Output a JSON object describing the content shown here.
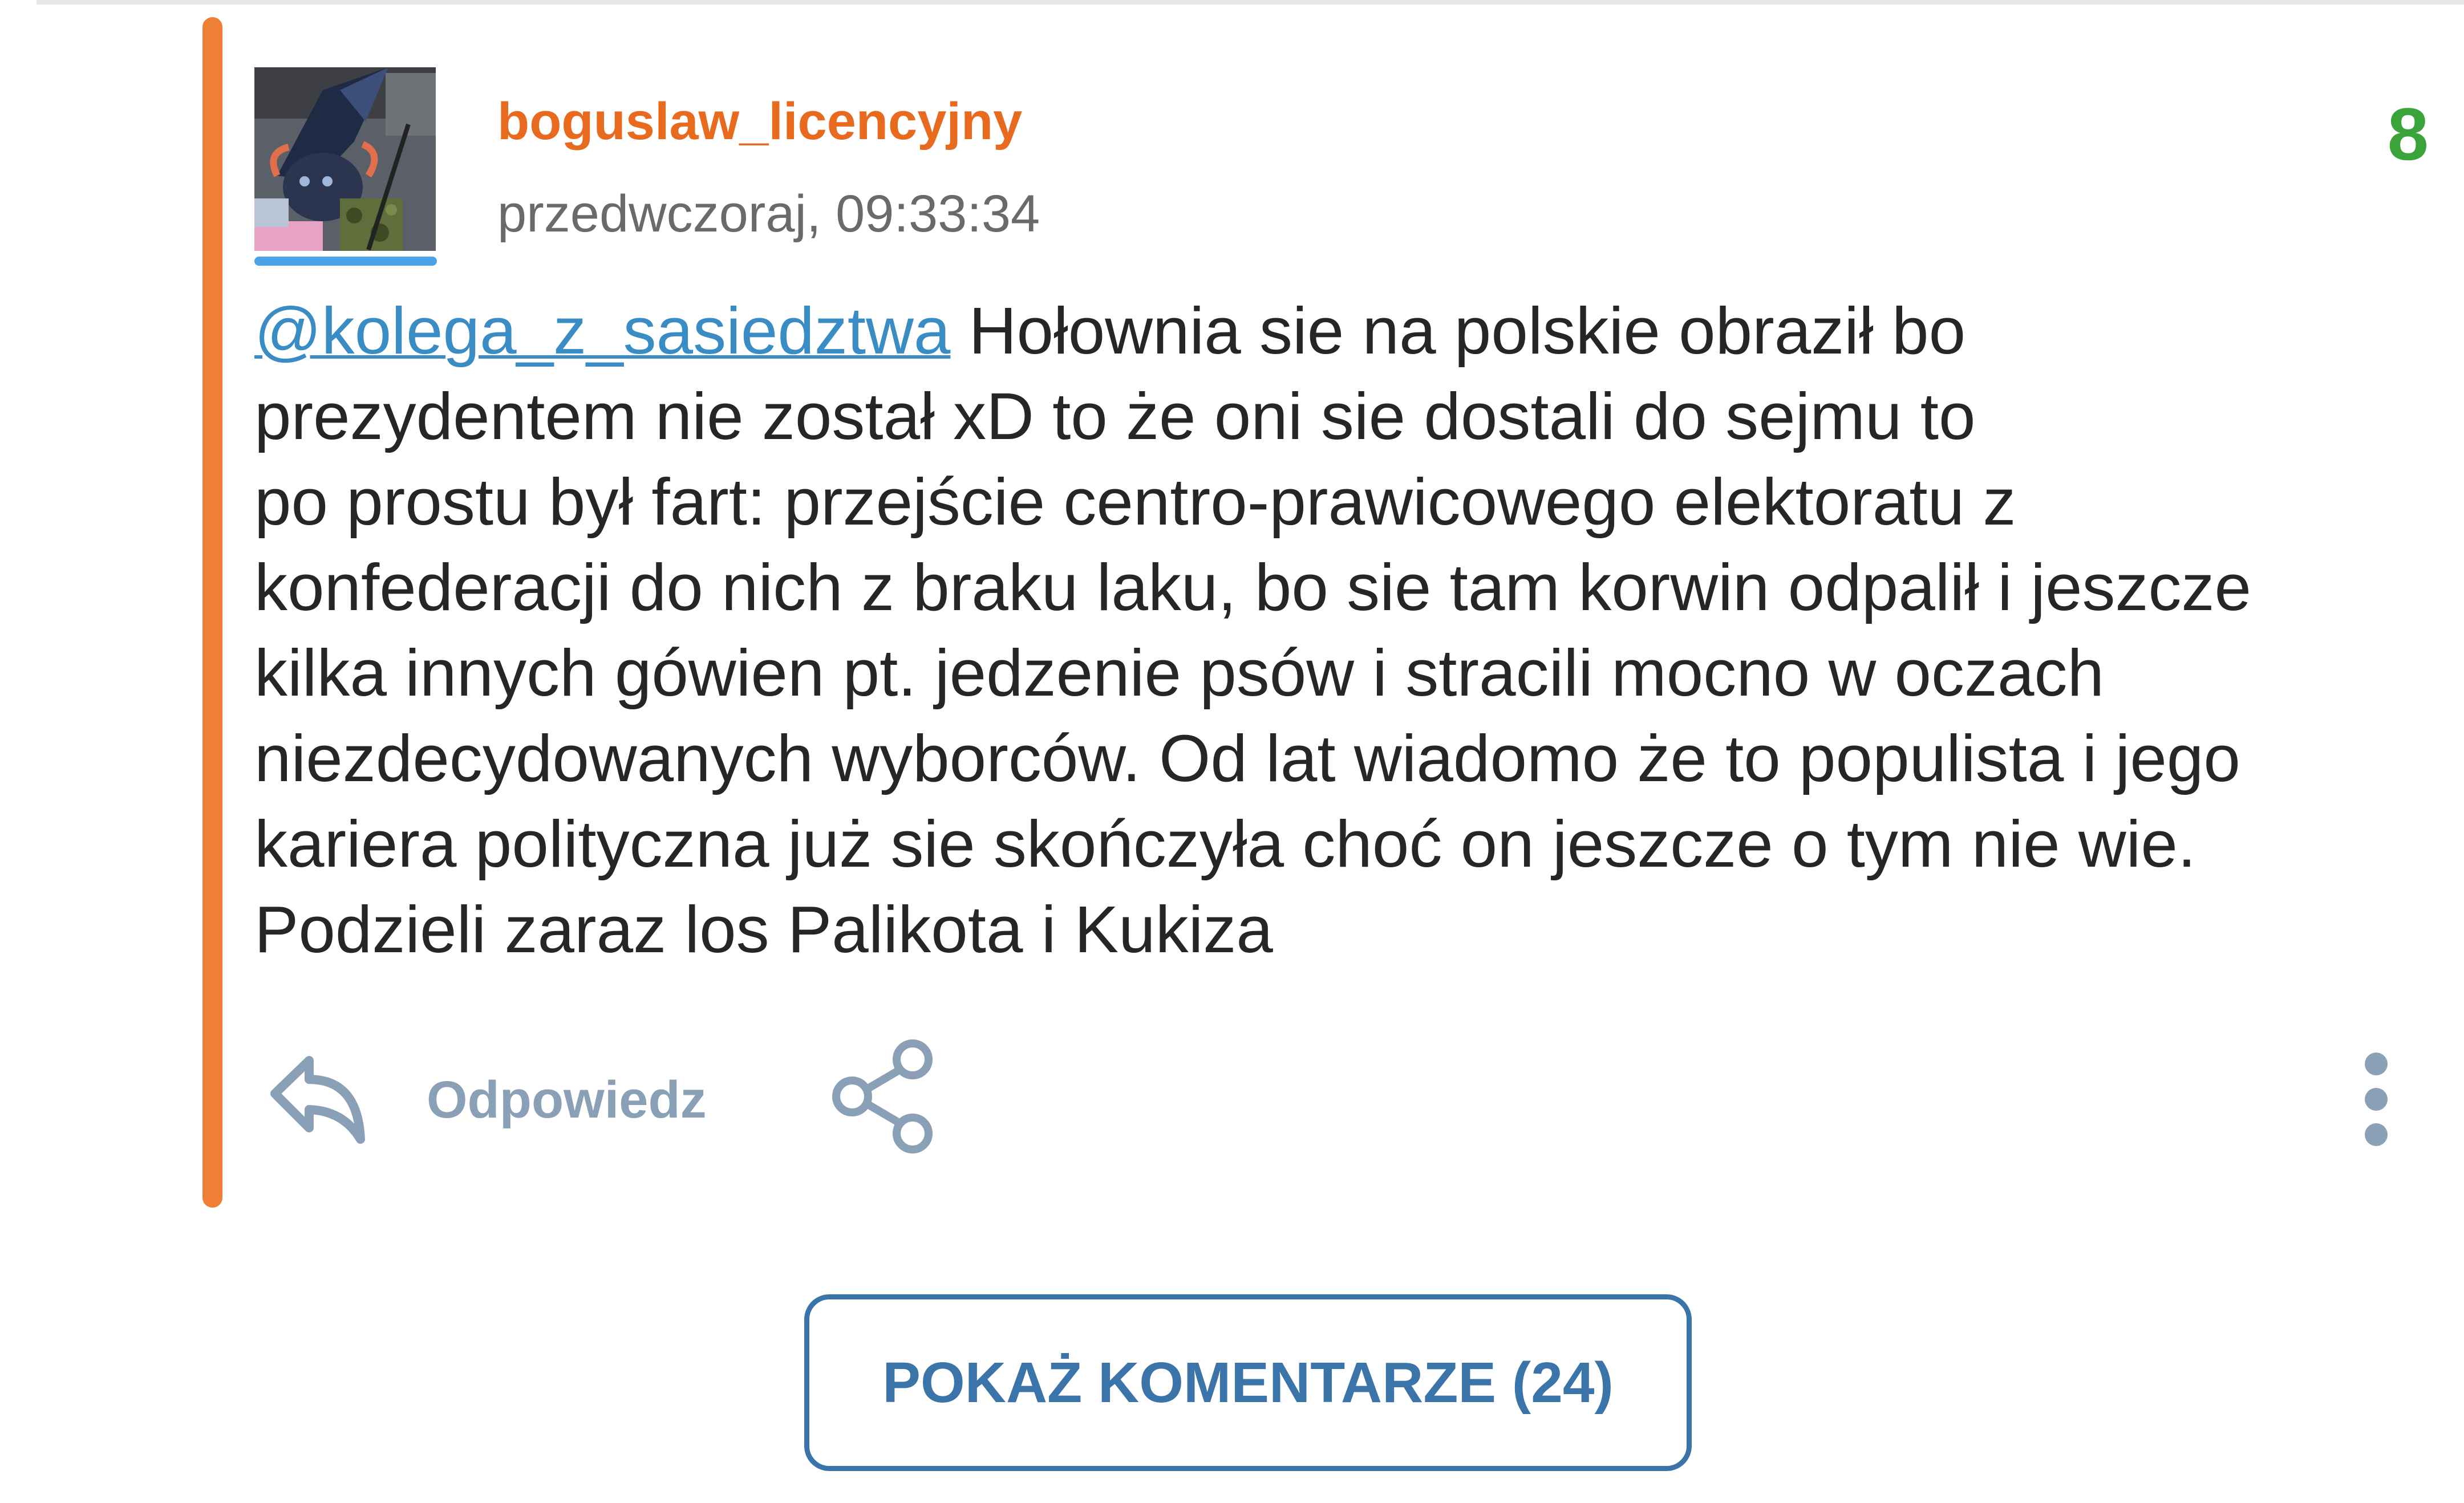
{
  "comment": {
    "author": "boguslaw_licencyjny",
    "timestamp": "przedwczoraj, 09:33:34",
    "score": "8",
    "mention": "@kolega_z_sasiedztwa",
    "lines": [
      " Hołownia sie na polskie obraził bo",
      "prezydentem nie został xD to że oni sie dostali do sejmu to",
      "po prostu był fart: przejście centro-prawicowego elektoratu z",
      "konfederacji do nich z braku laku, bo sie tam korwin odpalił i jeszcze",
      "kilka innych gówien pt. jedzenie psów i stracili mocno w oczach",
      "niezdecydowanych wyborców. Od lat wiadomo że to populista i jego",
      "kariera polityczna już sie skończyła choć on jeszcze o tym nie wie.",
      "Podzieli zaraz los Palikota i Kukiza"
    ]
  },
  "actions": {
    "reply_label": "Odpowiedz",
    "reply_icon": "reply-arrow-icon",
    "share_icon": "share-icon",
    "more_icon": "more-vertical-icon"
  },
  "show_comments_label": "POKAŻ KOMENTARZE (24)",
  "colors": {
    "thread_bar": "#f07f36",
    "author": "#e86a1f",
    "score": "#3aa33a",
    "mention": "#3a8cc4",
    "action": "#8aa0b6",
    "button": "#3b74a8"
  }
}
